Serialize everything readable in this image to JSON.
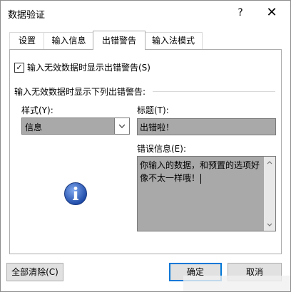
{
  "window": {
    "title": "数据验证",
    "help_label": "?",
    "close_label": "✕"
  },
  "tabs": [
    {
      "label": "设置"
    },
    {
      "label": "输入信息"
    },
    {
      "label": "出错警告"
    },
    {
      "label": "输入法模式"
    }
  ],
  "active_tab": "出错警告",
  "alert": {
    "show_checkbox_label": "输入无效数据时显示出错警告(S)",
    "show_checked": true,
    "check_mark": "✓",
    "section_label": "输入无效数据时显示下列出错警告:",
    "style_label": "样式(Y):",
    "style_value": "信息",
    "title_label": "标题(T):",
    "title_value": "出错啦！",
    "error_label": "错误信息(E):",
    "error_value": "你输入的数据，和预置的选项好像不太一样哦！"
  },
  "buttons": {
    "clear_all": "全部清除(C)",
    "ok": "确定",
    "cancel": "取消"
  },
  "colors": {
    "accent": "#0078d7",
    "field_bg": "#a9a9a9",
    "info_icon": "#2458b8"
  }
}
